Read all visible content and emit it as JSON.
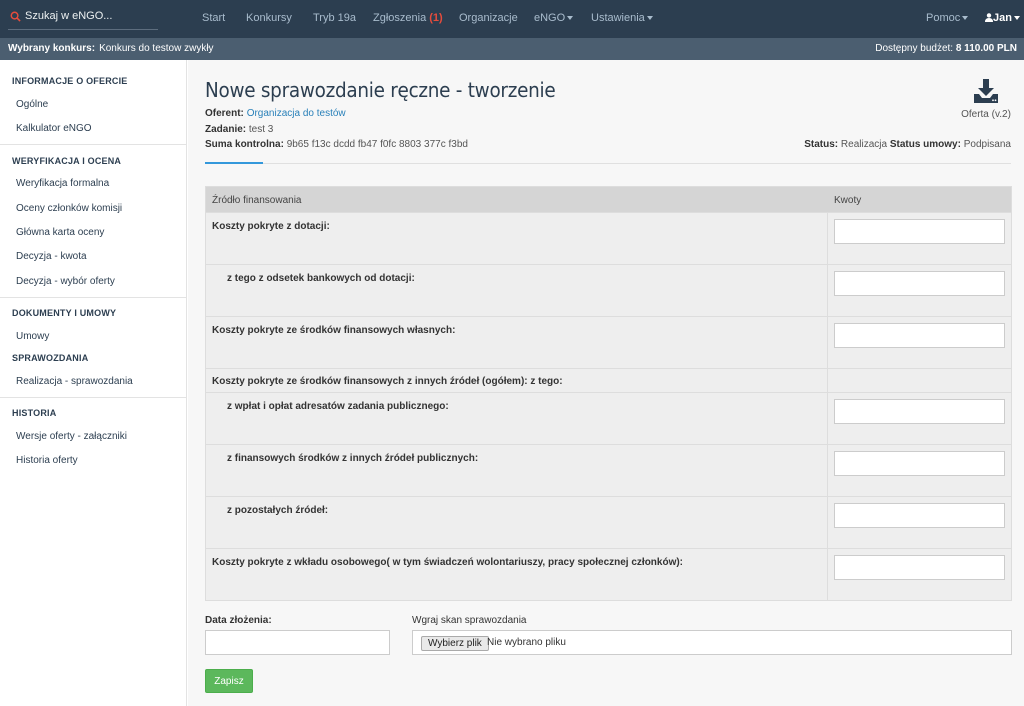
{
  "navbar": {
    "search_text": "Szukaj w eNGO...",
    "items": [
      "Start",
      "Konkursy",
      "Tryb 19a",
      "Zgłoszenia",
      "Organizacje",
      "eNGO",
      "Ustawienia"
    ],
    "zgloszenia_badge": "(1)",
    "help": "Pomoc",
    "user": "Jan"
  },
  "contest": {
    "label": "Wybrany konkurs:",
    "value": "Konkurs do testow zwykły",
    "budget_label": "Dostępny budżet:",
    "budget_value": "8 110.00 PLN"
  },
  "sidebar": {
    "sections": [
      {
        "title": "INFORMACJE O OFERCIE",
        "items": [
          "Ogólne",
          "Kalkulator eNGO"
        ]
      },
      {
        "title": "WERYFIKACJA I OCENA",
        "items": [
          "Weryfikacja formalna",
          "Oceny członków komisji",
          "Główna karta oceny",
          "Decyzja - kwota",
          "Decyzja - wybór oferty"
        ]
      },
      {
        "title": "DOKUMENTY I UMOWY",
        "items": [
          "Umowy"
        ]
      },
      {
        "title": "SPRAWOZDANIA",
        "items": [
          "Realizacja - sprawozdania"
        ]
      },
      {
        "title": "HISTORIA",
        "items": [
          "Wersje oferty - załączniki",
          "Historia oferty"
        ]
      }
    ]
  },
  "page": {
    "title": "Nowe sprawozdanie ręczne - tworzenie",
    "oferent_label": "Oferent:",
    "oferent_value": "Organizacja do testów",
    "zadanie_label": "Zadanie:",
    "zadanie_value": "test 3",
    "suma_label": "Suma kontrolna:",
    "suma_value": "9b65 f13c dcdd fb47 f0fc 8803 377c f3bd",
    "download_label": "Oferta (v.2)",
    "status_label": "Status:",
    "status_value": "Realizacja",
    "umowa_label": "Status umowy:",
    "umowa_value": "Podpisana"
  },
  "table": {
    "col1": "Źródło finansowania",
    "col2": "Kwoty",
    "rows": [
      "Koszty pokryte z dotacji:",
      "z tego z odsetek bankowych od dotacji:",
      "Koszty pokryte ze środków finansowych własnych:",
      "Koszty pokryte ze środków finansowych z innych źródeł (ogółem): z tego:",
      "z wpłat i opłat adresatów zadania publicznego:",
      "z finansowych środków z innych źródeł publicznych:",
      "z pozostałych źródeł:",
      "Koszty pokryte z wkładu osobowego( w tym świadczeń wolontariuszy, pracy społecznej członków):"
    ]
  },
  "form": {
    "date_label": "Data złożenia:",
    "upload_label": "Wgraj skan sprawozdania",
    "file_button": "Wybierz plik",
    "file_none": "Nie wybrano pliku",
    "save": "Zapisz"
  },
  "colors": {
    "navbar": "#2c3e50",
    "accent": "#3498db",
    "save": "#5cb85c",
    "badge": "#e74c3c"
  }
}
